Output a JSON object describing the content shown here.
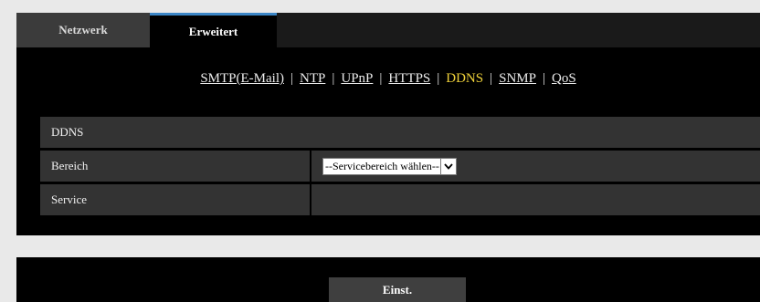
{
  "tabs": [
    {
      "label": "Netzwerk",
      "active": false
    },
    {
      "label": "Erweitert",
      "active": true
    }
  ],
  "subnav": {
    "items": [
      {
        "label": "SMTP(E-Mail)",
        "current": false
      },
      {
        "label": "NTP",
        "current": false
      },
      {
        "label": "UPnP",
        "current": false
      },
      {
        "label": "HTTPS",
        "current": false
      },
      {
        "label": "DDNS",
        "current": true
      },
      {
        "label": "SNMP",
        "current": false
      },
      {
        "label": "QoS",
        "current": false
      }
    ],
    "separator": "|"
  },
  "section": {
    "title": "DDNS",
    "rows": [
      {
        "label": "Bereich",
        "select_value": "--Servicebereich wählen--"
      },
      {
        "label": "Service",
        "value": ""
      }
    ]
  },
  "footer": {
    "apply_label": "Einst."
  },
  "colors": {
    "current_link": "#f0d23a",
    "active_tab_accent": "#3c86c6",
    "row_background": "#333333",
    "panel_background": "#000000"
  }
}
